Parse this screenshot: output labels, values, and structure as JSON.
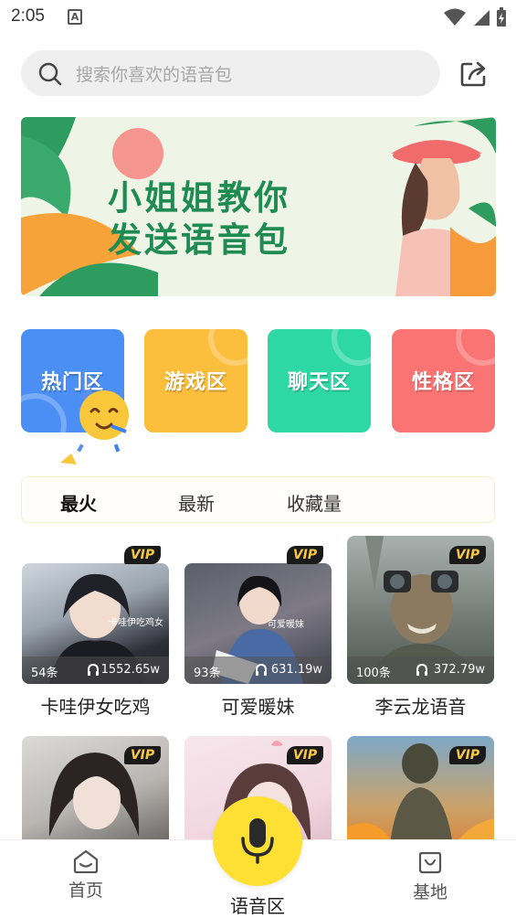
{
  "status_bar": {
    "time": "2:05",
    "notification_glyph": "A"
  },
  "search": {
    "placeholder": "搜索你喜欢的语音包"
  },
  "banner": {
    "line1": "小姐姐教你",
    "line2": "发送语音包"
  },
  "categories": [
    {
      "label": "热门区",
      "color": "#4b8ff5"
    },
    {
      "label": "游戏区",
      "color": "#fbbe3d"
    },
    {
      "label": "聊天区",
      "color": "#2ed8a5"
    },
    {
      "label": "性格区",
      "color": "#fb7474"
    }
  ],
  "tabs": [
    {
      "label": "最火",
      "active": true
    },
    {
      "label": "最新",
      "active": false
    },
    {
      "label": "收藏量",
      "active": false
    }
  ],
  "cards": [
    {
      "name": "卡哇伊女吃鸡",
      "count": "54条",
      "plays": "1552.65w",
      "badge": "VIP",
      "overlay_text": "卡哇伊吃鸡女"
    },
    {
      "name": "可爱暖妹",
      "count": "93条",
      "plays": "631.19w",
      "badge": "VIP",
      "overlay_text": "可爱暖妹"
    },
    {
      "name": "李云龙语音",
      "count": "100条",
      "plays": "372.79w",
      "badge": "VIP",
      "overlay_text": ""
    },
    {
      "name": "",
      "count": "",
      "plays": "",
      "badge": "VIP",
      "overlay_text": ""
    },
    {
      "name": "",
      "count": "",
      "plays": "",
      "badge": "VIP",
      "overlay_text": ""
    },
    {
      "name": "",
      "count": "",
      "plays": "",
      "badge": "VIP",
      "overlay_text": ""
    }
  ],
  "bottom_nav": {
    "home": "首页",
    "voice_zone": "语音区",
    "base": "基地"
  },
  "colors": {
    "accent": "#fde033",
    "banner_text": "#1f8b52",
    "vip_text": "#f6c945"
  }
}
